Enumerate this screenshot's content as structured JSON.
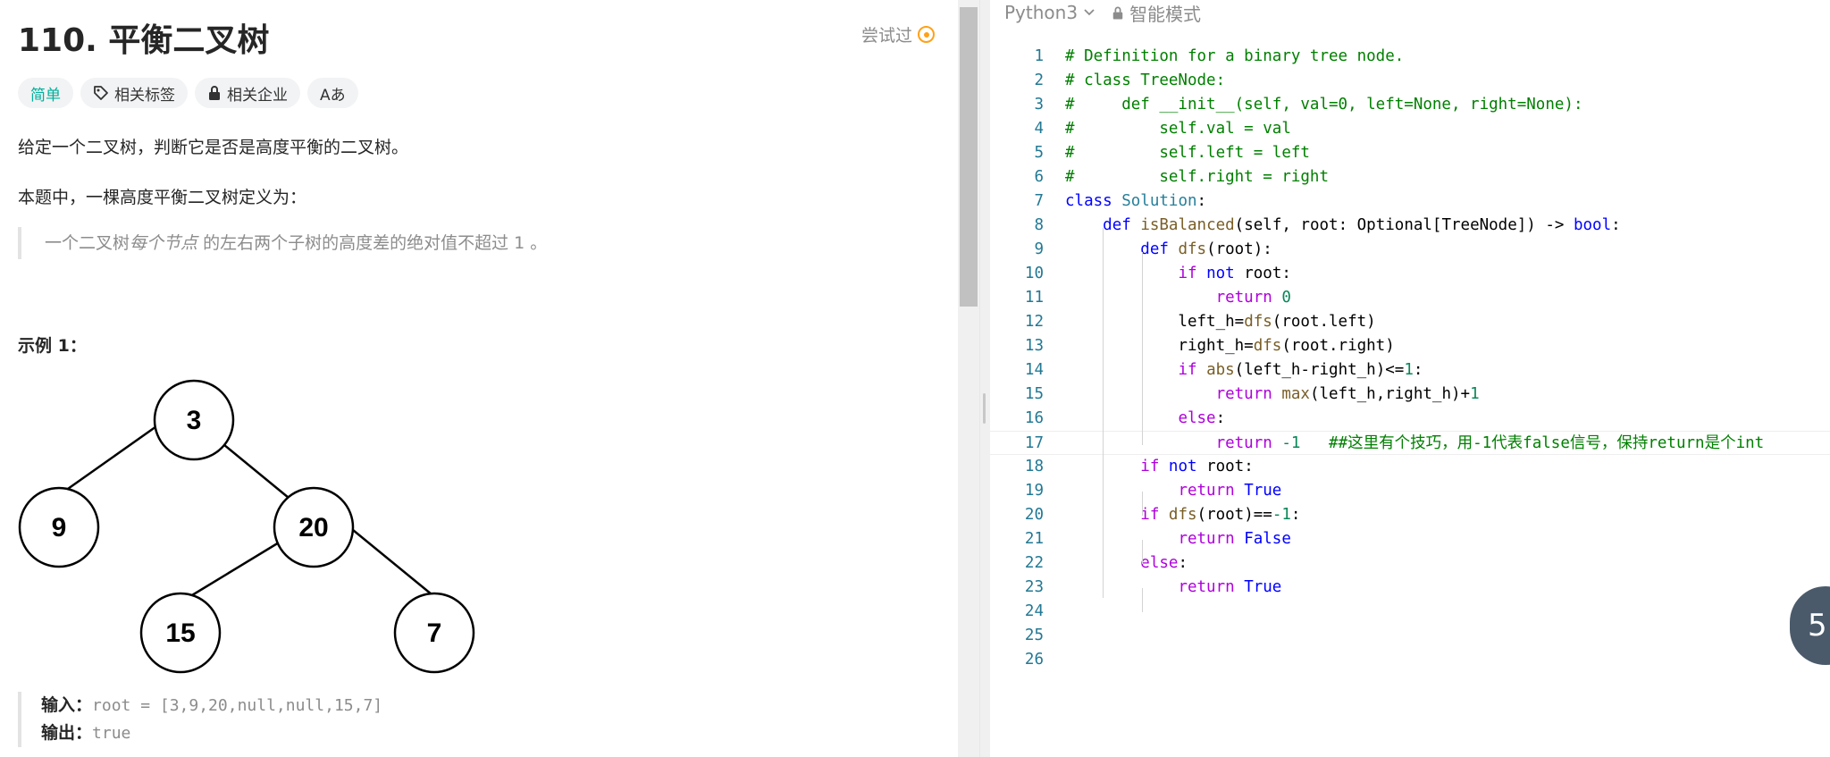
{
  "problem": {
    "title": "110. 平衡二叉树",
    "tried_label": "尝试过",
    "tags": {
      "difficulty": "简单",
      "related_tags": "相关标签",
      "related_companies": "相关企业",
      "font_toggle": "Aあ"
    },
    "description_1": "给定一个二叉树，判断它是否是高度平衡的二叉树。",
    "description_2": "本题中，一棵高度平衡二叉树定义为：",
    "quote_pre": "一个二叉树",
    "quote_em": "每个节点",
    "quote_post": "的左右两个子树的高度差的绝对值不超过 1 。",
    "example_title": "示例 1：",
    "tree_nodes": [
      "3",
      "9",
      "20",
      "15",
      "7"
    ],
    "input_label": "输入：",
    "input_value": "root = [3,9,20,null,null,15,7]",
    "output_label": "输出：",
    "output_value": "true"
  },
  "editor": {
    "language": "Python3",
    "mode": "智能模式",
    "line_numbers": [
      "1",
      "2",
      "3",
      "4",
      "5",
      "6",
      "7",
      "8",
      "9",
      "10",
      "11",
      "12",
      "13",
      "14",
      "15",
      "16",
      "17",
      "18",
      "19",
      "20",
      "21",
      "22",
      "23",
      "24",
      "25",
      "26"
    ],
    "lines": [
      "# Definition for a binary tree node.",
      "# class TreeNode:",
      "#     def __init__(self, val=0, left=None, right=None):",
      "#         self.val = val",
      "#         self.left = left",
      "#         self.right = right",
      "class Solution:",
      "    def isBalanced(self, root: Optional[TreeNode]) -> bool:",
      "        def dfs(root):",
      "            if not root:",
      "                return 0",
      "            left_h=dfs(root.left)",
      "            right_h=dfs(root.right)",
      "            if abs(left_h-right_h)<=1:",
      "                return max(left_h,right_h)+1",
      "            else:",
      "                return -1   ##这里有个技巧，用-1代表false信号，保持return是个int",
      "        if not root:",
      "            return True",
      "        if dfs(root)==-1:",
      "            return False",
      "        else:",
      "            return True",
      "",
      "",
      ""
    ]
  },
  "floating_badge": "5",
  "colors": {
    "easy": "#00af9b",
    "tried": "#ffa116",
    "comment": "#008000",
    "keyword": "#0000ff",
    "control": "#af00db",
    "function": "#795e26",
    "number": "#098658",
    "class": "#267f99",
    "line_number": "#237893"
  }
}
